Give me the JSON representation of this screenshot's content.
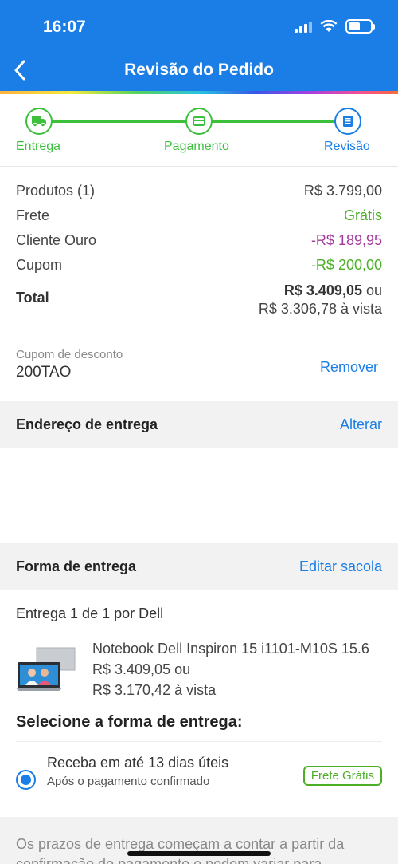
{
  "status": {
    "time": "16:07"
  },
  "nav": {
    "title": "Revisão do Pedido"
  },
  "steps": [
    {
      "label": "Entrega",
      "state": "done",
      "icon": "truck-icon"
    },
    {
      "label": "Pagamento",
      "state": "done",
      "icon": "card-icon"
    },
    {
      "label": "Revisão",
      "state": "active",
      "icon": "document-icon"
    }
  ],
  "summary": {
    "produtos_label": "Produtos (1)",
    "produtos_value": "R$ 3.799,00",
    "frete_label": "Frete",
    "frete_value": "Grátis",
    "cliente_label": "Cliente Ouro",
    "cliente_value": "-R$ 189,95",
    "cupom_label": "Cupom",
    "cupom_value": "-R$ 200,00",
    "total_label": "Total",
    "total_value": "R$ 3.409,05",
    "total_ou": " ou",
    "total_vista": "R$ 3.306,78 à vista"
  },
  "coupon": {
    "label": "Cupom de desconto",
    "code": "200TAO",
    "remove": "Remover"
  },
  "address": {
    "title": "Endereço de entrega",
    "action": "Alterar"
  },
  "shipping": {
    "title": "Forma de entrega",
    "action": "Editar sacola"
  },
  "delivery": {
    "by_prefix": "Entrega 1 de 1",
    "by_suffix": " por Dell",
    "product_name": "Notebook Dell Inspiron 15 i1101-M10S 15.6",
    "price": "R$ 3.409,05 ou",
    "price_vista": "R$ 3.170,42 à vista",
    "select_title": "Selecione a forma de entrega:",
    "option_main": "Receba em até 13 dias úteis",
    "option_sub": "Após o pagamento confirmado",
    "option_badge": "Frete Grátis"
  },
  "notice": "Os prazos de entrega começam a contar a partir da confirmação do pagamento e podem variar para",
  "colors": {
    "primary": "#1b7ee6",
    "success": "#4caf27",
    "discount": "#a23a9a"
  }
}
